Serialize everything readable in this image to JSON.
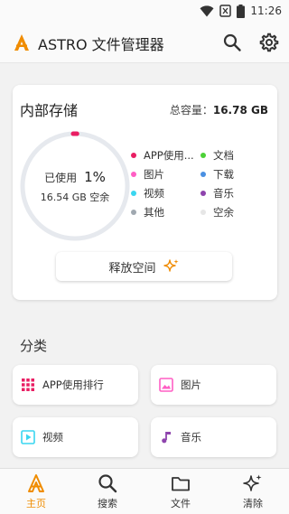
{
  "status_bar": {
    "time": "11:26",
    "icons": [
      "wifi-icon",
      "sim-no-signal-icon",
      "battery-icon"
    ]
  },
  "app_bar": {
    "title": "ASTRO 文件管理器",
    "actions": [
      "search-icon",
      "settings-gear-icon"
    ]
  },
  "storage": {
    "title": "内部存储",
    "total_label": "总容量：",
    "total_value": "16.78 GB",
    "used_label": "已使用",
    "used_percent": "1%",
    "used_fraction": 0.01,
    "used_size": "16.54 GB 空余",
    "legend": [
      {
        "label": "APP使用...",
        "color": "#e91e63"
      },
      {
        "label": "文档",
        "color": "#4cd137"
      },
      {
        "label": "图片",
        "color": "#ff5ec4"
      },
      {
        "label": "下载",
        "color": "#4a90e2"
      },
      {
        "label": "视频",
        "color": "#3ad6f0"
      },
      {
        "label": "音乐",
        "color": "#8e44ad"
      },
      {
        "label": "其他",
        "color": "#a0a8b0"
      },
      {
        "label": "空余",
        "color": "#e6e6e6"
      }
    ],
    "release_button": "释放空间"
  },
  "categories": {
    "title": "分类",
    "items": [
      {
        "label": "APP使用排行",
        "icon": "app-grid-icon",
        "color": "#e91e63"
      },
      {
        "label": "图片",
        "icon": "image-icon",
        "color": "#ff5ec4"
      },
      {
        "label": "视频",
        "icon": "video-icon",
        "color": "#3ad6f0"
      },
      {
        "label": "音乐",
        "icon": "music-note-icon",
        "color": "#8e44ad"
      }
    ]
  },
  "bottom_nav": {
    "items": [
      {
        "label": "主页",
        "icon": "astro-home-icon",
        "active": true
      },
      {
        "label": "搜索",
        "icon": "search-icon",
        "active": false
      },
      {
        "label": "文件",
        "icon": "folder-icon",
        "active": false
      },
      {
        "label": "清除",
        "icon": "sparkle-clean-icon",
        "active": false
      }
    ]
  },
  "colors": {
    "accent": "#f08c00",
    "background": "#f2f2f2",
    "card": "#ffffff"
  }
}
